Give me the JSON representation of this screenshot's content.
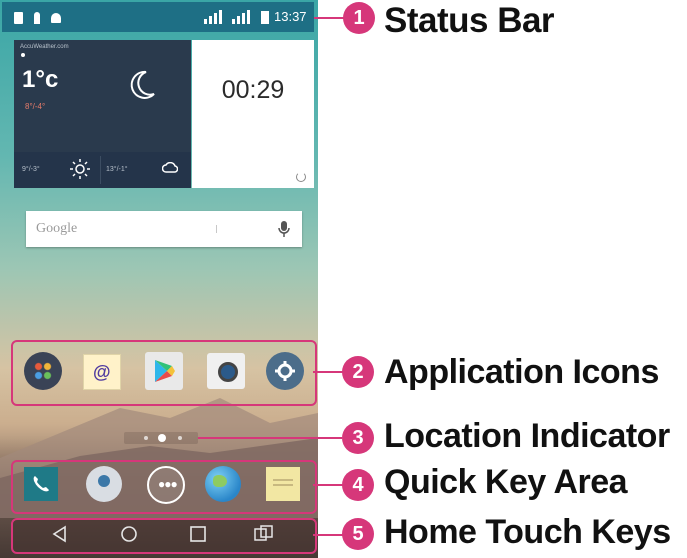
{
  "status_bar": {
    "time": "13:37"
  },
  "weather_widget": {
    "source": "AccuWeather.com",
    "temperature": "1°c",
    "high_low": "8°/-4°",
    "forecast_1": "9°/-3°",
    "forecast_2": "13°/-1°"
  },
  "clock_widget": {
    "time": "00:29"
  },
  "google_bar": {
    "text": "Google"
  },
  "callouts": [
    {
      "number": "1",
      "label": "Status Bar"
    },
    {
      "number": "2",
      "label": "Application Icons"
    },
    {
      "number": "3",
      "label": "Location Indicator"
    },
    {
      "number": "4",
      "label": "Quick Key Area"
    },
    {
      "number": "5",
      "label": "Home Touch Keys"
    }
  ],
  "colors": {
    "accent": "#d6377a",
    "status_bar": "#1e6f85",
    "weather_bg": "#2a3a4d"
  },
  "icons": {
    "apps": [
      "app-folder-icon",
      "email-icon",
      "play-store-icon",
      "camera-icon",
      "settings-icon"
    ],
    "quick_keys": [
      "phone-icon",
      "contacts-icon",
      "apps-drawer-icon",
      "browser-icon",
      "memo-icon"
    ],
    "home_keys": [
      "back-icon",
      "home-icon",
      "recent-apps-icon",
      "dual-window-icon"
    ]
  }
}
